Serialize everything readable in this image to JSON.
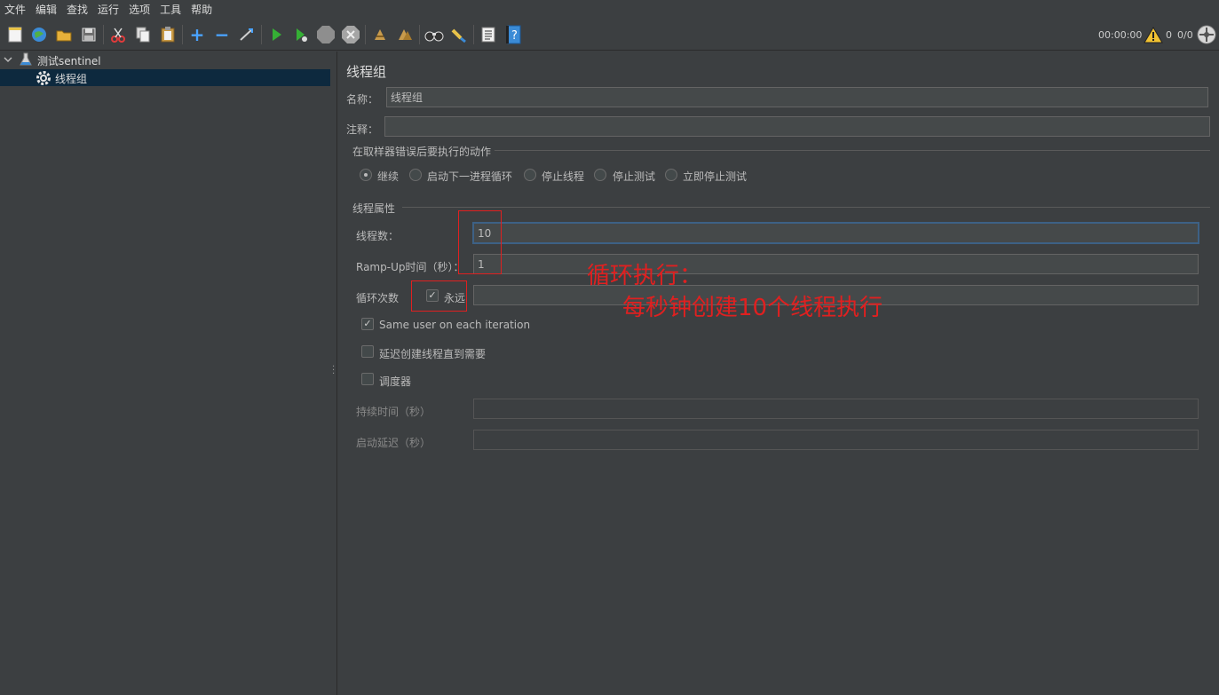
{
  "menu": [
    "文件",
    "编辑",
    "查找",
    "运行",
    "选项",
    "工具",
    "帮助"
  ],
  "toolbar": {
    "icons": [
      "new-icon",
      "templates-icon",
      "open-icon",
      "save-icon",
      "cut-icon",
      "copy-icon",
      "paste-icon",
      "expand-icon",
      "collapse-icon",
      "toggle-icon",
      "start-icon",
      "start-no-pause-icon",
      "stop-icon",
      "shutdown-icon",
      "clear-icon",
      "clear-all-icon",
      "search-icon",
      "reset-search-icon",
      "function-helper-icon",
      "help-icon"
    ],
    "timer": "00:00:00",
    "warning_count": "0",
    "threads": "0/0"
  },
  "tree": {
    "root_label": "测试sentinel",
    "child_label": "线程组"
  },
  "panel": {
    "title": "线程组",
    "name_label": "名称：",
    "name_value": "线程组",
    "comment_label": "注释：",
    "comment_value": "",
    "error_action_title": "在取样器错误后要执行的动作",
    "error_actions": [
      "继续",
      "启动下一进程循环",
      "停止线程",
      "停止测试",
      "立即停止测试"
    ],
    "thread_props_title": "线程属性",
    "threads_label": "线程数：",
    "threads_value": "10",
    "rampup_label": "Ramp-Up时间（秒）：",
    "rampup_value": "1",
    "loop_label": "循环次数",
    "forever_label": "永远",
    "loop_value": "",
    "same_user_label": "Same user on each iteration",
    "delay_label": "延迟创建线程直到需要",
    "scheduler_label": "调度器",
    "duration_label": "持续时间（秒）",
    "duration_value": "",
    "startup_delay_label": "启动延迟（秒）",
    "startup_delay_value": ""
  },
  "annotation": {
    "line1": "循环执行：",
    "line2": "每秒钟创建10个线程执行",
    "color": "#e02020"
  }
}
